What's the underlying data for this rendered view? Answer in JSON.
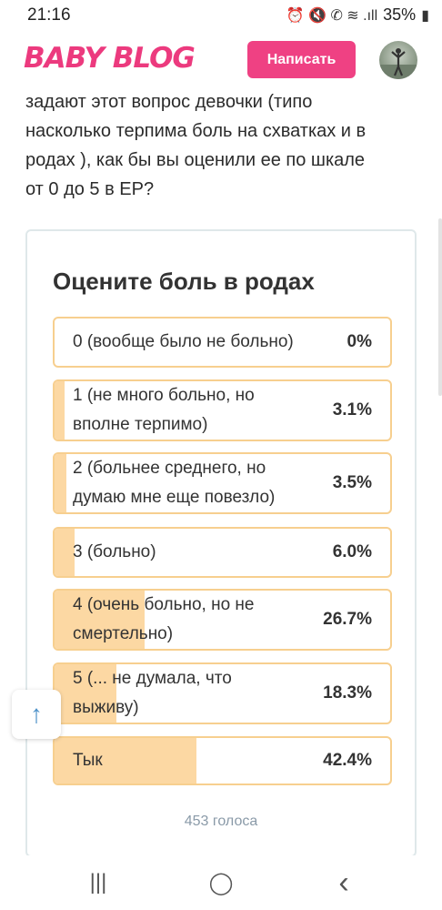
{
  "status_bar": {
    "time": "21:16",
    "icons_text": "⏰ 🔇 ✆ ≋ .ıll",
    "battery": "35%"
  },
  "header": {
    "logo": "BABY BLOG",
    "write_button": "Написать"
  },
  "article": {
    "lines": [
      "задают этот вопрос девочки (типо",
      "насколько терпима боль на схватках и в",
      "родах ), как бы вы оценили ее по шкале",
      "от 0 до 5 в ЕР?"
    ]
  },
  "poll": {
    "title": "Оцените боль в родах",
    "options": [
      {
        "label_lines": [
          "0 (вообще было не больно)"
        ],
        "percent_text": "0%",
        "percent": 0
      },
      {
        "label_lines": [
          "1 (не много больно, но",
          "вполне терпимо)"
        ],
        "percent_text": "3.1%",
        "percent": 3.1
      },
      {
        "label_lines": [
          "2 (больнее среднего, но",
          "думаю мне еще повезло)"
        ],
        "percent_text": "3.5%",
        "percent": 3.5
      },
      {
        "label_lines": [
          "3 (больно)"
        ],
        "percent_text": "6.0%",
        "percent": 6.0
      },
      {
        "label_lines": [
          "4 (очень больно, но не",
          "смертельно)"
        ],
        "percent_text": "26.7%",
        "percent": 26.7
      },
      {
        "label_lines": [
          "5 (... не думала, что",
          "выживу)"
        ],
        "percent_text": "18.3%",
        "percent": 18.3
      },
      {
        "label_lines": [
          "Тык"
        ],
        "percent_text": "42.4%",
        "percent": 42.4
      }
    ],
    "votes": "453 голоса"
  },
  "scroll_top": {
    "icon": "arrow-up-icon",
    "glyph": "↑"
  },
  "nav": {
    "recents_glyph": "|||",
    "home_glyph": "◯",
    "back_glyph": "‹"
  },
  "colors": {
    "brand_pink": "#ec3a7e",
    "option_border": "#f7cf8f",
    "option_fill": "#fcd8a3"
  }
}
